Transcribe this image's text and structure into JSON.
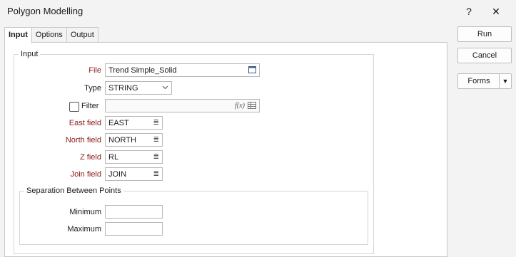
{
  "window": {
    "title": "Polygon Modelling",
    "help_glyph": "?",
    "close_glyph": "✕"
  },
  "tabs": [
    "Input",
    "Options",
    "Output"
  ],
  "buttons": {
    "run": "Run",
    "cancel": "Cancel",
    "forms": "Forms",
    "forms_arrow": "▼"
  },
  "input_group": {
    "legend": "Input",
    "file": {
      "label": "File",
      "value": "Trend Simple_Solid"
    },
    "type": {
      "label": "Type",
      "value": "STRING"
    },
    "filter": {
      "label": "Filter",
      "value": "",
      "checked": false,
      "fx": "f(x)"
    },
    "east_field": {
      "label": "East field",
      "value": "EAST"
    },
    "north_field": {
      "label": "North field",
      "value": "NORTH"
    },
    "z_field": {
      "label": "Z field",
      "value": "RL"
    },
    "join_field": {
      "label": "Join field",
      "value": "JOIN"
    }
  },
  "separation_group": {
    "legend": "Separation Between Points",
    "minimum": {
      "label": "Minimum",
      "value": ""
    },
    "maximum": {
      "label": "Maximum",
      "value": ""
    }
  }
}
